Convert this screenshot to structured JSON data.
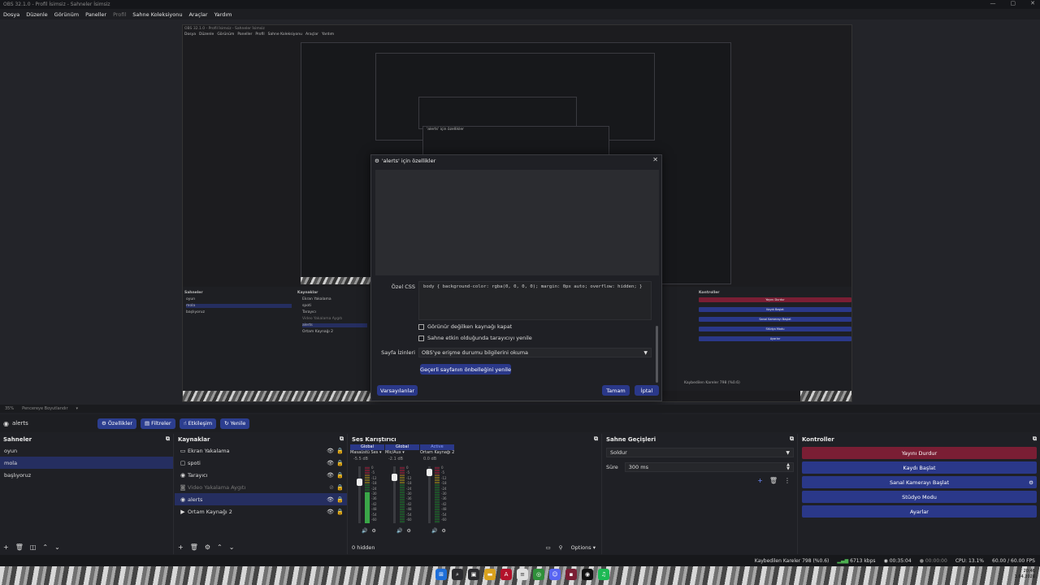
{
  "window": {
    "title": "OBS 32.1.0 - Profil İsimsiz - Sahneler İsimsiz",
    "controls": [
      "—",
      "▢",
      "✕"
    ]
  },
  "menu": [
    "Dosya",
    "Düzenle",
    "Görünüm",
    "Paneller",
    "Profil",
    "Sahne Koleksiyonu",
    "Araçlar",
    "Yardım"
  ],
  "zoom": {
    "value": "35%",
    "mode": "Pencereye Boyutlandır"
  },
  "source_toolbar": {
    "name": "alerts",
    "buttons": [
      "Özellikler",
      "Filtreler",
      "Etkileşim",
      "Yenile"
    ]
  },
  "scenes": {
    "title": "Sahneler",
    "items": [
      "oyun",
      "mola",
      "başlıyoruz"
    ],
    "selected": 1
  },
  "sources": {
    "title": "Kaynaklar",
    "items": [
      {
        "name": "Ekran Yakalama",
        "icon": "monitor-icon",
        "dim": false
      },
      {
        "name": "spoti",
        "icon": "window-icon",
        "dim": false
      },
      {
        "name": "Tarayıcı",
        "icon": "globe-icon",
        "dim": false
      },
      {
        "name": "Video Yakalama Aygıtı",
        "icon": "camera-icon",
        "dim": true
      },
      {
        "name": "alerts",
        "icon": "globe-icon",
        "dim": false,
        "selected": true
      },
      {
        "name": "Ortam Kaynağı 2",
        "icon": "play-icon",
        "dim": false
      }
    ]
  },
  "mixer": {
    "title": "Ses Karıştırıcı",
    "channels": [
      {
        "tag": "Global",
        "name": "Masaüstü Ses",
        "db": "-5.5 dB",
        "level": 0.55,
        "fader": 0.75
      },
      {
        "tag": "Global",
        "name": "Mic/Aux",
        "db": "-2.1 dB",
        "level": 0.0,
        "fader": 0.85
      },
      {
        "tag": "Active",
        "name": "Ortam Kaynağı 2",
        "db": "0.0 dB",
        "level": 0.0,
        "fader": 0.95
      }
    ],
    "scale": [
      "0",
      "-5",
      "-12",
      "-18",
      "-24",
      "-30",
      "-36",
      "-42",
      "-48",
      "-54",
      "-60"
    ],
    "hidden": "0 hidden",
    "options": "Options"
  },
  "transitions": {
    "title": "Sahne Geçişleri",
    "type": "Soldur",
    "duration_label": "Süre",
    "duration": "300 ms"
  },
  "controls": {
    "title": "Kontroller",
    "buttons": [
      "Yayını Durdur",
      "Kaydı Başlat",
      "Sanal Kamerayı Başlat",
      "Stüdyo Modu",
      "Ayarlar"
    ]
  },
  "status": {
    "dropped": "Kaybedilen Kareler 798 (%0.6)",
    "kbps": "6713 kbps",
    "live": "00:35:04",
    "rec": "00:00:00",
    "cpu": "CPU: 13.1%",
    "fps": "60.00 / 60.00 FPS"
  },
  "clock": {
    "time": "20:46",
    "date": "1.04.2026"
  },
  "dialog": {
    "title": "'alerts' için özellikler",
    "css_label": "Özel CSS",
    "css": "body { background-color: rgba(0, 0, 0, 0); margin: 0px auto; overflow: hidden; }",
    "check1": "Görünür değilken kaynağı kapat",
    "check2": "Sahne etkin olduğunda tarayıcıyı yenile",
    "perm_label": "Sayfa İzinleri",
    "perm_value": "OBS'ye erişme durumu bilgilerini okuma",
    "refresh": "Geçerli sayfanın önbelleğini yenile",
    "defaults": "Varsayılanlar",
    "ok": "Tamam",
    "cancel": "İptal"
  },
  "nested": {
    "dialog_title": "'alerts' için özellikler",
    "scenes": [
      "oyun",
      "mola",
      "başlıyoruz"
    ],
    "sources": [
      "Ekran Yakalama",
      "spoti",
      "Tarayıcı",
      "Video Yakalama Aygıtı",
      "alerts",
      "Ortam Kaynağı 2"
    ],
    "controls": [
      "Yayını Durdur",
      "Kaydı Başlat",
      "Sanal Kamerayı Başlat",
      "Stüdyo Modu",
      "Ayarlar"
    ],
    "status": "Kaybedilen Kareler 798 (%0.6)"
  },
  "colors": {
    "accent": "#2a3889",
    "stop": "#7a1e34",
    "selected": "#252e60"
  }
}
